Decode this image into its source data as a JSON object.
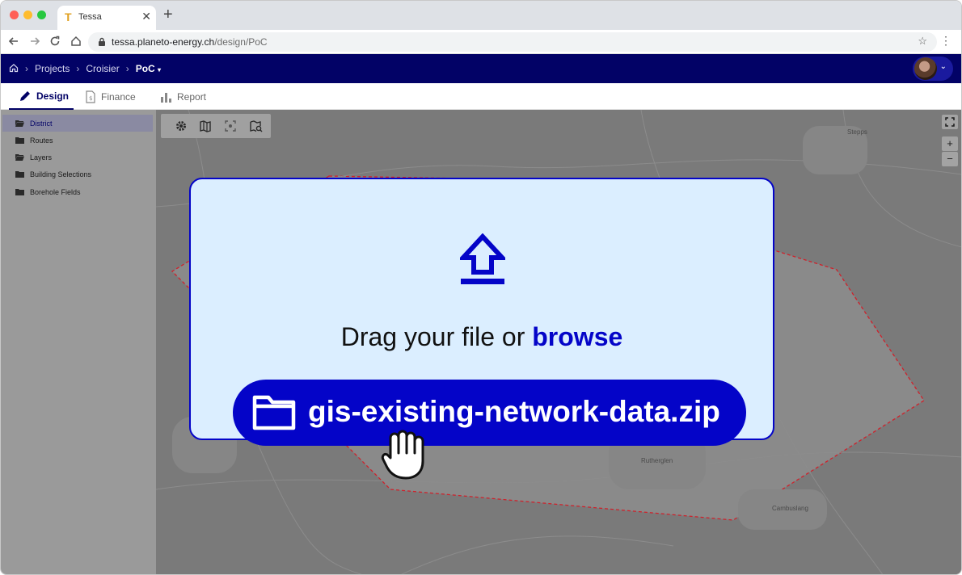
{
  "browser": {
    "tab_title": "Tessa",
    "tab_favicon": "T",
    "url_host": "tessa.planeto-energy.ch",
    "url_path": "/design/PoC"
  },
  "breadcrumbs": {
    "home_icon": "home-icon",
    "items": [
      "Projects",
      "Croisier",
      "PoC"
    ]
  },
  "app_tabs": [
    {
      "label": "Design",
      "icon": "pencil-icon",
      "active": true
    },
    {
      "label": "Finance",
      "icon": "invoice-icon",
      "active": false
    },
    {
      "label": "Report",
      "icon": "bar-chart-icon",
      "active": false
    }
  ],
  "sidebar": {
    "items": [
      {
        "label": "District",
        "icon": "folder-open-icon",
        "selected": true
      },
      {
        "label": "Routes",
        "icon": "folder-icon",
        "selected": false
      },
      {
        "label": "Layers",
        "icon": "folder-open-icon",
        "selected": false
      },
      {
        "label": "Building Selections",
        "icon": "folder-icon",
        "selected": false
      },
      {
        "label": "Borehole Fields",
        "icon": "folder-icon",
        "selected": false
      }
    ]
  },
  "map": {
    "place_labels": [
      "Stepps",
      "Rutherglen",
      "Cambuslang"
    ],
    "zoom_in": "+",
    "zoom_out": "−",
    "toolbar_icons": [
      "gear-icon",
      "map-icon",
      "focus-icon",
      "map-search-icon"
    ]
  },
  "upload": {
    "drag_text": "Drag your file or",
    "browse_text": "browse",
    "file_name": "gis-existing-network-data.zip"
  },
  "colors": {
    "appbar": "#020266",
    "accent": "#0404c8",
    "upload_bg": "#dbeeff",
    "district_boundary": "#d0202a"
  }
}
